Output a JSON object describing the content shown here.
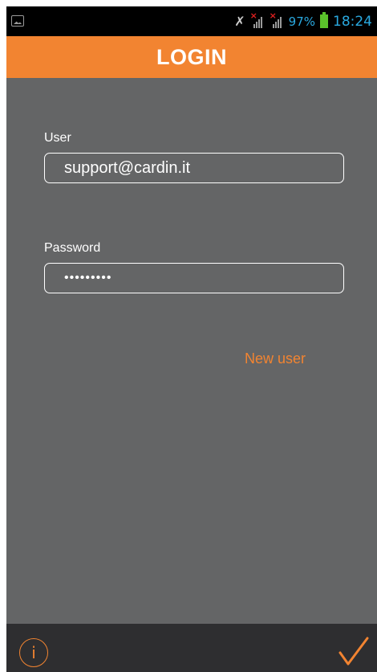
{
  "status_bar": {
    "battery_percent": "97%",
    "time": "18:24",
    "icons": [
      "gallery-icon",
      "mute-icon",
      "signal-no-sim-icon",
      "signal-no-sim-icon",
      "battery-icon"
    ]
  },
  "header": {
    "title": "LOGIN"
  },
  "form": {
    "user_label": "User",
    "user_value": "support@cardin.it",
    "password_label": "Password",
    "password_value": "•••••••••"
  },
  "links": {
    "new_user": "New user"
  },
  "bottom_bar": {
    "info_glyph": "i",
    "icons": [
      "info-icon",
      "checkmark-icon"
    ]
  },
  "colors": {
    "accent": "#f28431",
    "background": "#646566",
    "bottom_bar": "#2e2e30",
    "status_text": "#2aa9e0"
  }
}
